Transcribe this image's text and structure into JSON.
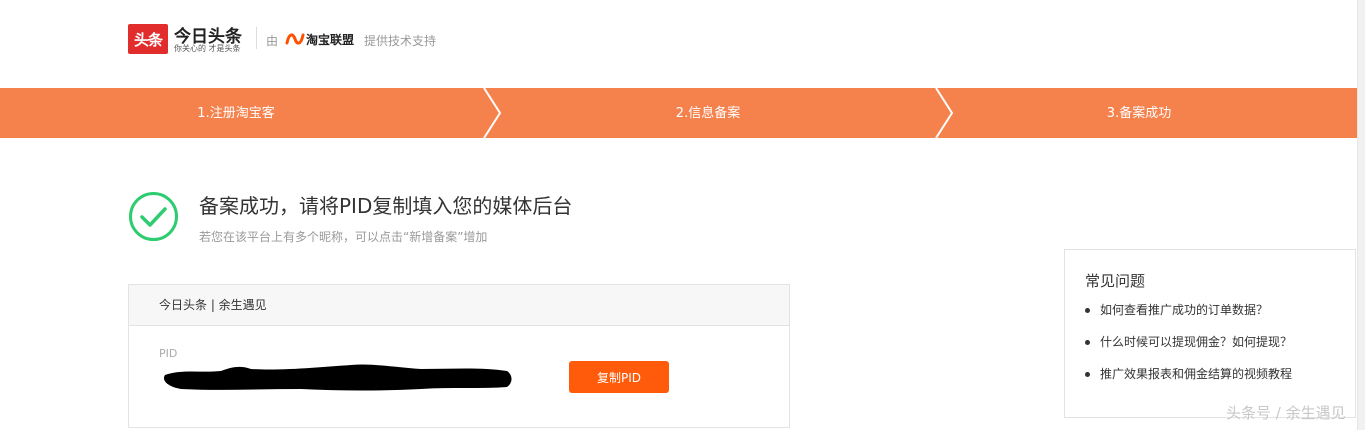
{
  "header": {
    "logo_badge": "头条",
    "logo_name": "今日头条",
    "logo_slogan": "你关心的 才是头条",
    "by_text": "由",
    "partner_name": "淘宝联盟",
    "support_text": "提供技术支持"
  },
  "steps": [
    {
      "label": "1.注册淘宝客"
    },
    {
      "label": "2.信息备案"
    },
    {
      "label": "3.备案成功"
    }
  ],
  "success": {
    "title": "备案成功，请将PID复制填入您的媒体后台",
    "hint": "若您在该平台上有多个昵称，可以点击“新增备案”增加"
  },
  "card": {
    "header": "今日头条 | 余生遇见",
    "pid_label": "PID",
    "copy_button": "复制PID"
  },
  "faq": {
    "title": "常见问题",
    "items": [
      "如何查看推广成功的订单数据？",
      "什么时候可以提现佣金？如何提现？",
      "推广效果报表和佣金结算的视频教程"
    ]
  },
  "watermark": "头条号 / 余生遇见",
  "colors": {
    "step_bar": "#f5814c",
    "button": "#ff5b0a",
    "success_green": "#2ecc71",
    "logo_red": "#e22d2d"
  },
  "icons": [
    "success-check-icon",
    "taobao-alliance-logo-icon",
    "redaction-mark"
  ]
}
